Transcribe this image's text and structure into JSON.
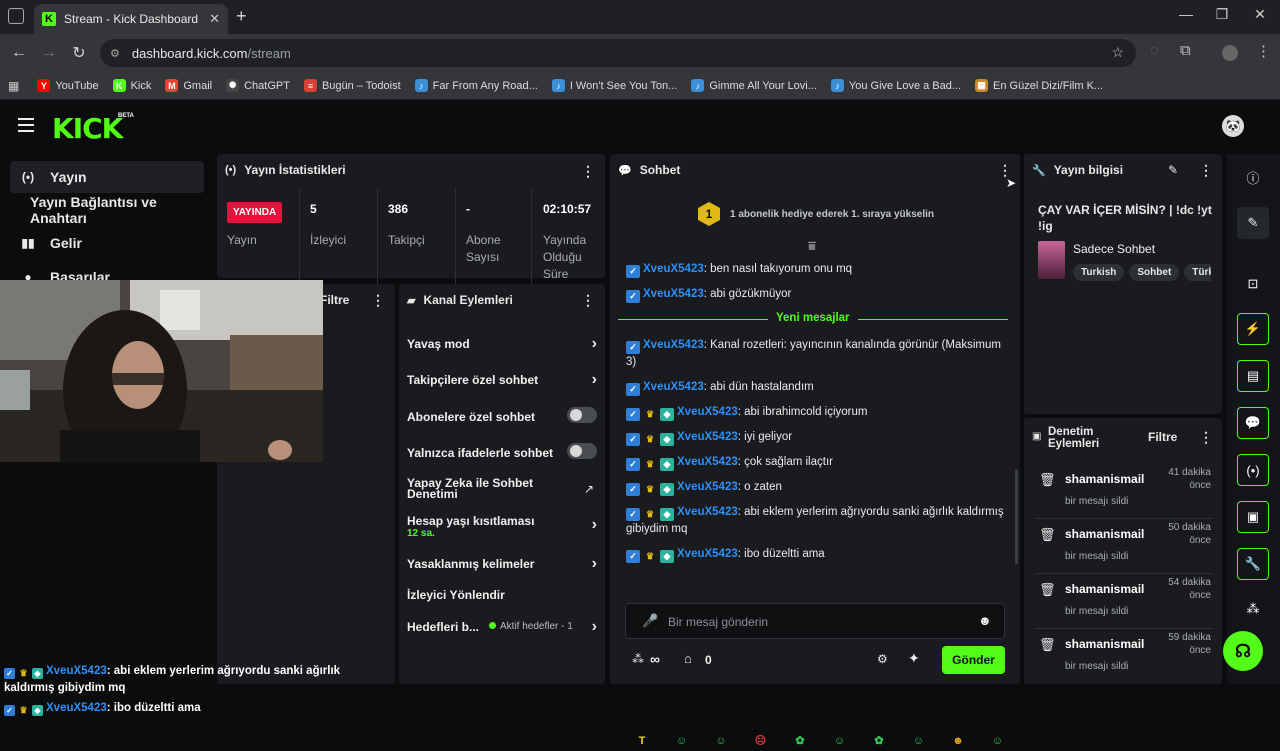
{
  "browser": {
    "tab_title": "Stream - Kick Dashboard",
    "tab_favicon": "K",
    "url_host": "dashboard.kick.com",
    "url_path": "/stream",
    "bookmarks": [
      {
        "label": "YouTube",
        "color": "#ff0000",
        "icon": "Y"
      },
      {
        "label": "Kick",
        "color": "#53fc18",
        "icon": "K"
      },
      {
        "label": "Gmail",
        "color": "#ea4335",
        "icon": "M"
      },
      {
        "label": "ChatGPT",
        "color": "#444444",
        "icon": "✺"
      },
      {
        "label": "Bugün – Todoist",
        "color": "#db4035",
        "icon": "≡"
      },
      {
        "label": "Far From Any Road...",
        "color": "#3b8fd8",
        "icon": "♪"
      },
      {
        "label": "I Won't See You Ton...",
        "color": "#3b8fd8",
        "icon": "♪"
      },
      {
        "label": "Gimme All Your Lovi...",
        "color": "#3b8fd8",
        "icon": "♪"
      },
      {
        "label": "You Give Love a Bad...",
        "color": "#3b8fd8",
        "icon": "♪"
      },
      {
        "label": "En Güzel Dizi/Film K...",
        "color": "#c98a2e",
        "icon": "▦"
      }
    ]
  },
  "kick": {
    "logo": "KICK",
    "beta": "BETA",
    "sidebar": [
      {
        "label": "Yayın",
        "icon": "(•)"
      },
      {
        "label": "Yayın Bağlantısı ve Anahtarı",
        "icon": ""
      },
      {
        "label": "Gelir",
        "icon": "▮▮"
      },
      {
        "label": "Başarılar",
        "icon": "●"
      }
    ]
  },
  "stats": {
    "title": "Yayın İstatistikleri",
    "live_badge": "YAYINDA",
    "live_label": "Yayın",
    "viewers_value": "5",
    "viewers_label": "İzleyici",
    "followers_value": "386",
    "followers_label": "Takipçi",
    "subs_value": "-",
    "subs_label_1": "Abone",
    "subs_label_2": "Sayısı",
    "duration_value": "02:10:57",
    "duration_label_1": "Yayında",
    "duration_label_2": "Olduğu",
    "duration_label_3": "Süre"
  },
  "filter_panel": {
    "title": "Filtre"
  },
  "channel_actions": {
    "title": "Kanal Eylemleri",
    "slow_mode": "Yavaş mod",
    "followers_chat": "Takipçilere özel sohbet",
    "subs_chat": "Abonelere özel sohbet",
    "emote_chat": "Yalnızca ifadelerle sohbet",
    "ai_moderation": "Yapay Zeka ile Sohbet Denetimi",
    "account_age": "Hesap yaşı kısıtlaması",
    "account_age_value": "12 sa.",
    "banned_words": "Yasaklanmış kelimeler",
    "viewer_redirect": "İzleyici Yönlendir",
    "goals": "Hedefleri b...",
    "goals_status": "Aktif hedefler - 1"
  },
  "chat": {
    "title": "Sohbet",
    "gift_rank": "1",
    "gift_text": "1 abonelik hediye ederek 1. sıraya yükselin",
    "new_messages": "Yeni mesajlar",
    "input_placeholder": "Bir mesaj gönderin",
    "points_symbol": "∞",
    "store_count": "0",
    "send": "Gönder",
    "messages": [
      {
        "user": "XveuX5423",
        "text": ": ben nasıl takıyorum onu mq"
      },
      {
        "user": "XveuX5423",
        "text": ": abi gözükmüyor"
      },
      {
        "user": "XveuX5423",
        "text": ": Kanal rozetleri: yayıncının kanalında görünür (Maksimum 3)"
      },
      {
        "user": "XveuX5423",
        "text": ": abi dün hastalandım"
      },
      {
        "user": "XveuX5423",
        "text": ": abi ibrahimcold içiyorum"
      },
      {
        "user": "XveuX5423",
        "text": ": iyi geliyor"
      },
      {
        "user": "XveuX5423",
        "text": ": çok sağlam ilaçtır"
      },
      {
        "user": "XveuX5423",
        "text": ": o zaten"
      },
      {
        "user": "XveuX5423",
        "text": ": abi eklem yerlerim ağrıyordu sanki ağırlık kaldırmış gibiydim mq"
      },
      {
        "user": "XveuX5423",
        "text": ": ibo düzeltti ama"
      }
    ],
    "emotes": [
      {
        "glyph": "T",
        "color": "#f5d90a"
      },
      {
        "glyph": "☺",
        "color": "#33cc55"
      },
      {
        "glyph": "☺",
        "color": "#33cc55"
      },
      {
        "glyph": "☹",
        "color": "#e03a3a"
      },
      {
        "glyph": "✿",
        "color": "#33cc55"
      },
      {
        "glyph": "☺",
        "color": "#33cc55"
      },
      {
        "glyph": "✿",
        "color": "#33cc55"
      },
      {
        "glyph": "☺",
        "color": "#33cc55"
      },
      {
        "glyph": "☻",
        "color": "#e0a020"
      },
      {
        "glyph": "☺",
        "color": "#33cc55"
      }
    ]
  },
  "stream_info": {
    "title": "Yayın bilgisi",
    "stream_title": "ÇAY VAR İÇER MİSİN? | !dc !yt !ig",
    "category": "Sadece Sohbet",
    "tags": [
      "Turkish",
      "Sohbet",
      "Türk"
    ]
  },
  "moderation": {
    "title_1": "Denetim",
    "title_2": "Eylemleri",
    "filter": "Filtre",
    "rows": [
      {
        "user": "shamanismail",
        "action": "bir mesajı sildi",
        "time_1": "41 dakika",
        "time_2": "önce"
      },
      {
        "user": "shamanismail",
        "action": "bir mesajı sildi",
        "time_1": "50 dakika",
        "time_2": "önce"
      },
      {
        "user": "shamanismail",
        "action": "bir mesajı sildi",
        "time_1": "54 dakika",
        "time_2": "önce"
      },
      {
        "user": "shamanismail",
        "action": "bir mesajı sildi",
        "time_1": "59 dakika",
        "time_2": "önce"
      }
    ]
  },
  "overlay_chat": [
    {
      "user": "XveuX5423",
      "text": ": abi eklem yerlerim ağrıyordu sanki ağırlık kaldırmış gibiydim mq"
    },
    {
      "user": "XveuX5423",
      "text": ": ibo düzeltti ama"
    }
  ],
  "colors": {
    "accent": "#53fc18",
    "live": "#e9113c",
    "username": "#2f90f5"
  }
}
